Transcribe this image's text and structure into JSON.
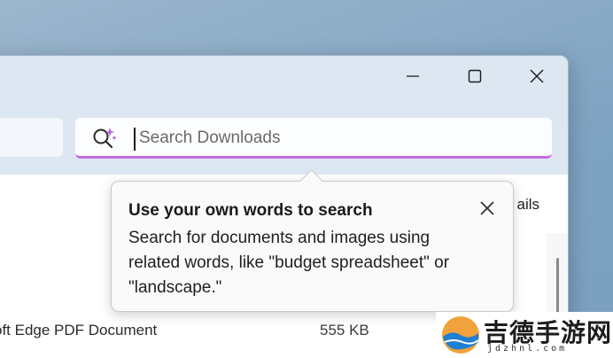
{
  "search": {
    "placeholder": "Search Downloads",
    "accent_color": "#c86adf"
  },
  "titlebar": {
    "minimize_icon": "minimize-icon",
    "maximize_icon": "maximize-icon",
    "close_icon": "close-icon"
  },
  "view": {
    "details_label_partial": "ails"
  },
  "file_row": {
    "type": "oft Edge PDF Document",
    "size": "555 KB"
  },
  "tooltip": {
    "title": "Use your own words to search",
    "body": "Search for documents and images using related words, like \"budget spreadsheet\" or \"landscape.\"",
    "close_icon": "close-icon"
  },
  "watermark": {
    "text": "吉德手游网",
    "subtext": "jdzhnl.com"
  }
}
